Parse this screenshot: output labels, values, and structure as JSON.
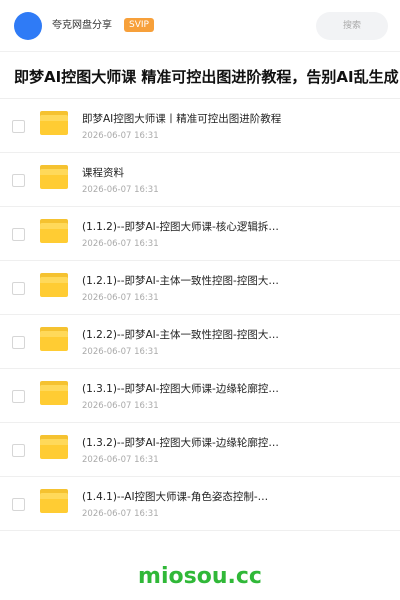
{
  "header": {
    "username": "夸克网盘分享",
    "badge": "SVIP",
    "search_placeholder": "搜索",
    "icons": {
      "avatar": "avatar-circle"
    },
    "colors": {
      "avatar": "#2f7bf6",
      "badge": "#f7a03a"
    }
  },
  "page": {
    "title": "即梦AI控图大师课 精准可控出图进阶教程，告别AI乱生成，"
  },
  "files": [
    {
      "name": "即梦AI控图大师课丨精准可控出图进阶教程",
      "date": "2026-06-07 16:31"
    },
    {
      "name": "课程资料",
      "date": "2026-06-07 16:31"
    },
    {
      "name": "(1.1.2)--即梦AI-控图大师课-核心逻辑拆…",
      "date": "2026-06-07 16:31"
    },
    {
      "name": "(1.2.1)--即梦AI-主体一致性控图-控图大…",
      "date": "2026-06-07 16:31"
    },
    {
      "name": "(1.2.2)--即梦AI-主体一致性控图-控图大…",
      "date": "2026-06-07 16:31"
    },
    {
      "name": "(1.3.1)--即梦AI-控图大师课-边缘轮廓控…",
      "date": "2026-06-07 16:31"
    },
    {
      "name": "(1.3.2)--即梦AI-控图大师课-边缘轮廓控…",
      "date": "2026-06-07 16:31"
    },
    {
      "name": "(1.4.1)--AI控图大师课-角色姿态控制-…",
      "date": "2026-06-07 16:31"
    }
  ],
  "file_icon": "folder-icon",
  "watermark": "miosou.cc",
  "colors": {
    "folder": "#ffcc33",
    "watermark": "#30b838"
  }
}
